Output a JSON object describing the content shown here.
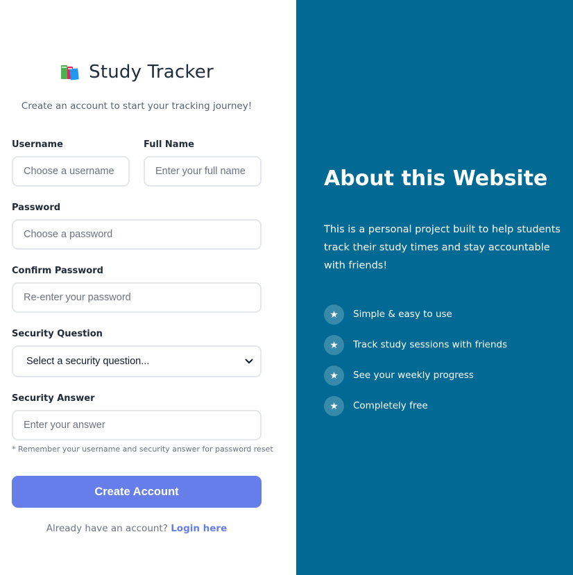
{
  "brand": {
    "title": "Study Tracker",
    "icon": "books-icon"
  },
  "subtitle": "Create an account to start your tracking journey!",
  "form": {
    "username": {
      "label": "Username",
      "placeholder": "Choose a username"
    },
    "full_name": {
      "label": "Full Name",
      "placeholder": "Enter your full name"
    },
    "password": {
      "label": "Password",
      "placeholder": "Choose a password"
    },
    "confirm_password": {
      "label": "Confirm Password",
      "placeholder": "Re-enter your password"
    },
    "security_question": {
      "label": "Security Question",
      "selected": "Select a security question..."
    },
    "security_answer": {
      "label": "Security Answer",
      "placeholder": "Enter your answer"
    },
    "note": "* Remember your username and security answer for password reset",
    "submit_label": "Create Account"
  },
  "login": {
    "prompt": "Already have an account?",
    "link": "Login here"
  },
  "about": {
    "title": "About this Website",
    "text": "This is a personal project built to help students track their study times and stay accountable with friends!",
    "features": [
      {
        "icon": "star-icon",
        "text": "Simple & easy to use"
      },
      {
        "icon": "star-icon",
        "text": "Track study sessions with friends"
      },
      {
        "icon": "star-icon",
        "text": "See your weekly progress"
      },
      {
        "icon": "star-icon",
        "text": "Completely free"
      }
    ]
  },
  "colors": {
    "panel": "#006a94",
    "accent": "#667eea",
    "border": "#e3e6ea"
  }
}
